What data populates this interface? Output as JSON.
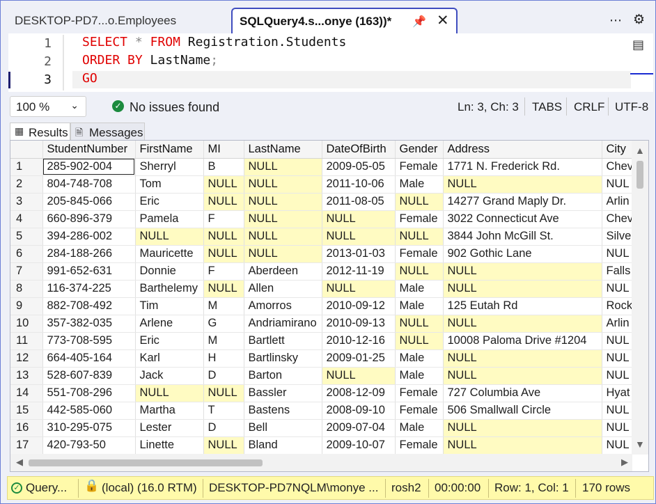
{
  "tabs": {
    "inactive_label": "DESKTOP-PD7...o.Employees",
    "active_label": "SQLQuery4.s...onye (163))*"
  },
  "editor": {
    "line_numbers": [
      "1",
      "2",
      "3"
    ],
    "line1": {
      "k1": "SELECT",
      "star": "*",
      "k2": "FROM",
      "rest": "Registration.Students"
    },
    "line2": {
      "k1": "ORDER BY",
      "rest": "LastName",
      "semi": ";"
    },
    "line3": {
      "k1": "GO"
    }
  },
  "infobar": {
    "zoom": "100 %",
    "issues": "No issues found",
    "position": "Ln: 3, Ch: 3",
    "tabs": "TABS",
    "eol": "CRLF",
    "encoding": "UTF-8"
  },
  "results_tabs": {
    "results": "Results",
    "messages": "Messages"
  },
  "grid": {
    "columns": [
      "StudentNumber",
      "FirstName",
      "MI",
      "LastName",
      "DateOfBirth",
      "Gender",
      "Address",
      "City"
    ],
    "rows": [
      [
        "1",
        "285-902-004",
        "Sherryl",
        "B",
        "NULL",
        "2009-05-05",
        "Female",
        "1771 N. Frederick Rd.",
        "Chev"
      ],
      [
        "2",
        "804-748-708",
        "Tom",
        "NULL",
        "NULL",
        "2011-10-06",
        "Male",
        "NULL",
        "NUL"
      ],
      [
        "3",
        "205-845-066",
        "Eric",
        "NULL",
        "NULL",
        "2011-08-05",
        "NULL",
        "14277 Grand Maply Dr.",
        "Arlin"
      ],
      [
        "4",
        "660-896-379",
        "Pamela",
        "F",
        "NULL",
        "NULL",
        "Female",
        "3022 Connecticut Ave",
        "Chev"
      ],
      [
        "5",
        "394-286-002",
        "NULL",
        "NULL",
        "NULL",
        "NULL",
        "NULL",
        "3844 John McGill St.",
        "Silve"
      ],
      [
        "6",
        "284-188-266",
        "Mauricette",
        "NULL",
        "NULL",
        "2013-01-03",
        "Female",
        "902 Gothic Lane",
        "NUL"
      ],
      [
        "7",
        "991-652-631",
        "Donnie",
        "F",
        "Aberdeen",
        "2012-11-19",
        "NULL",
        "NULL",
        "Falls"
      ],
      [
        "8",
        "116-374-225",
        "Barthelemy",
        "NULL",
        "Allen",
        "NULL",
        "Male",
        "NULL",
        "NUL"
      ],
      [
        "9",
        "882-708-492",
        "Tim",
        "M",
        "Amorros",
        "2010-09-12",
        "Male",
        "125 Eutah Rd",
        "Rock"
      ],
      [
        "10",
        "357-382-035",
        "Arlene",
        "G",
        "Andriamirano",
        "2010-09-13",
        "NULL",
        "NULL",
        "Arlin"
      ],
      [
        "11",
        "773-708-595",
        "Eric",
        "M",
        "Bartlett",
        "2010-12-16",
        "NULL",
        "10008 Paloma Drive #1204",
        "NUL"
      ],
      [
        "12",
        "664-405-164",
        "Karl",
        "H",
        "Bartlinsky",
        "2009-01-25",
        "Male",
        "NULL",
        "NUL"
      ],
      [
        "13",
        "528-607-839",
        "Jack",
        "D",
        "Barton",
        "NULL",
        "Male",
        "NULL",
        "NUL"
      ],
      [
        "14",
        "551-708-296",
        "NULL",
        "NULL",
        "Bassler",
        "2008-12-09",
        "Female",
        "727 Columbia Ave",
        "Hyat"
      ],
      [
        "15",
        "442-585-060",
        "Martha",
        "T",
        "Bastens",
        "2008-09-10",
        "Female",
        "506 Smallwall Circle",
        "NUL"
      ],
      [
        "16",
        "310-295-075",
        "Lester",
        "D",
        "Bell",
        "2009-07-04",
        "Male",
        "NULL",
        "NUL"
      ],
      [
        "17",
        "420-793-50",
        "Linette",
        "NULL",
        "Bland",
        "2009-10-07",
        "Female",
        "NULL",
        "NUL"
      ]
    ]
  },
  "statusbar": {
    "query": "Query...",
    "server": "(local) (16.0 RTM)",
    "user": "DESKTOP-PD7NQLM\\monye ...",
    "database": "rosh2",
    "elapsed": "00:00:00",
    "rowcol": "Row: 1, Col: 1",
    "rows": "170 rows"
  },
  "colors": {
    "null_cell": "#fffbc2",
    "keyword": "#e00000",
    "status_bar": "#fffaaa",
    "accent": "#3f4dbf"
  }
}
